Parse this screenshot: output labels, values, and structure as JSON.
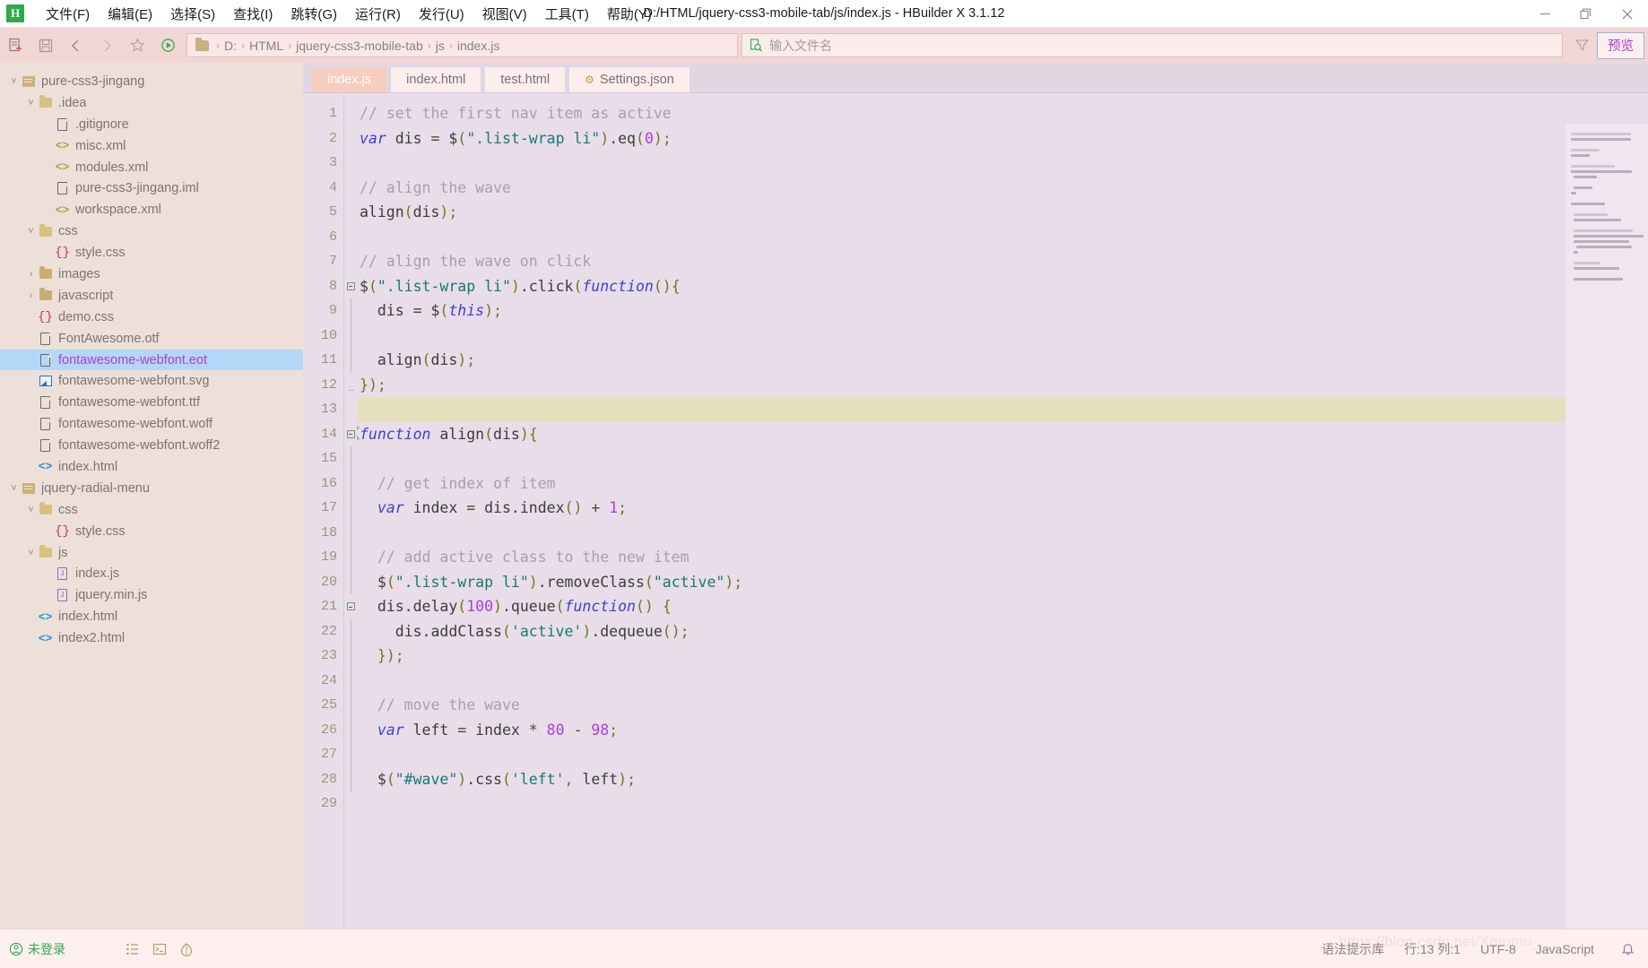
{
  "window": {
    "title": "D:/HTML/jquery-css3-mobile-tab/js/index.js - HBuilder X 3.1.12",
    "logo_letter": "H",
    "controls": {
      "minimize": "—",
      "maximize": "❐",
      "close": "✕"
    }
  },
  "menubar": {
    "items": [
      {
        "label": "文件(F)",
        "name": "menu-file"
      },
      {
        "label": "编辑(E)",
        "name": "menu-edit"
      },
      {
        "label": "选择(S)",
        "name": "menu-select"
      },
      {
        "label": "查找(I)",
        "name": "menu-find"
      },
      {
        "label": "跳转(G)",
        "name": "menu-goto"
      },
      {
        "label": "运行(R)",
        "name": "menu-run"
      },
      {
        "label": "发行(U)",
        "name": "menu-publish"
      },
      {
        "label": "视图(V)",
        "name": "menu-view"
      },
      {
        "label": "工具(T)",
        "name": "menu-tools"
      },
      {
        "label": "帮助(Y)",
        "name": "menu-help"
      }
    ]
  },
  "toolbar": {
    "icons": [
      "new-file-icon",
      "save-icon",
      "back-icon",
      "forward-icon",
      "star-icon",
      "run-icon"
    ],
    "breadcrumb": [
      "D:",
      "HTML",
      "jquery-css3-mobile-tab",
      "js",
      "index.js"
    ],
    "breadcrumb_separator": "›",
    "filename_placeholder": "输入文件名",
    "filter_icon": "filter-icon",
    "preview_label": "预览"
  },
  "sidebar": {
    "tree": [
      {
        "label": "pure-css3-jingang",
        "indent": 0,
        "twisty": "˅",
        "icon": "project",
        "selected": false
      },
      {
        "label": ".idea",
        "indent": 1,
        "twisty": "˅",
        "icon": "folder",
        "selected": false
      },
      {
        "label": ".gitignore",
        "indent": 2,
        "twisty": "",
        "icon": "file",
        "selected": false
      },
      {
        "label": "misc.xml",
        "indent": 2,
        "twisty": "",
        "icon": "xml",
        "selected": false
      },
      {
        "label": "modules.xml",
        "indent": 2,
        "twisty": "",
        "icon": "xml",
        "selected": false
      },
      {
        "label": "pure-css3-jingang.iml",
        "indent": 2,
        "twisty": "",
        "icon": "file",
        "selected": false
      },
      {
        "label": "workspace.xml",
        "indent": 2,
        "twisty": "",
        "icon": "xml",
        "selected": false
      },
      {
        "label": "css",
        "indent": 1,
        "twisty": "˅",
        "icon": "folder",
        "selected": false
      },
      {
        "label": "style.css",
        "indent": 2,
        "twisty": "",
        "icon": "css",
        "selected": false
      },
      {
        "label": "images",
        "indent": 1,
        "twisty": "›",
        "icon": "folder-closed",
        "selected": false
      },
      {
        "label": "javascript",
        "indent": 1,
        "twisty": "›",
        "icon": "folder-closed",
        "selected": false
      },
      {
        "label": "demo.css",
        "indent": 1,
        "twisty": "",
        "icon": "css",
        "selected": false
      },
      {
        "label": "FontAwesome.otf",
        "indent": 1,
        "twisty": "",
        "icon": "file",
        "selected": false
      },
      {
        "label": "fontawesome-webfont.eot",
        "indent": 1,
        "twisty": "",
        "icon": "file",
        "selected": true
      },
      {
        "label": "fontawesome-webfont.svg",
        "indent": 1,
        "twisty": "",
        "icon": "image",
        "selected": false
      },
      {
        "label": "fontawesome-webfont.ttf",
        "indent": 1,
        "twisty": "",
        "icon": "file",
        "selected": false
      },
      {
        "label": "fontawesome-webfont.woff",
        "indent": 1,
        "twisty": "",
        "icon": "file",
        "selected": false
      },
      {
        "label": "fontawesome-webfont.woff2",
        "indent": 1,
        "twisty": "",
        "icon": "file",
        "selected": false
      },
      {
        "label": "index.html",
        "indent": 1,
        "twisty": "",
        "icon": "html",
        "selected": false
      },
      {
        "label": "jquery-radial-menu",
        "indent": 0,
        "twisty": "˅",
        "icon": "project",
        "selected": false
      },
      {
        "label": "css",
        "indent": 1,
        "twisty": "˅",
        "icon": "folder",
        "selected": false
      },
      {
        "label": "style.css",
        "indent": 2,
        "twisty": "",
        "icon": "css",
        "selected": false
      },
      {
        "label": "js",
        "indent": 1,
        "twisty": "˅",
        "icon": "folder",
        "selected": false
      },
      {
        "label": "index.js",
        "indent": 2,
        "twisty": "",
        "icon": "js",
        "selected": false
      },
      {
        "label": "jquery.min.js",
        "indent": 2,
        "twisty": "",
        "icon": "js",
        "selected": false
      },
      {
        "label": "index.html",
        "indent": 1,
        "twisty": "",
        "icon": "html",
        "selected": false
      },
      {
        "label": "index2.html",
        "indent": 1,
        "twisty": "",
        "icon": "html",
        "selected": false
      }
    ]
  },
  "editor": {
    "tabs": [
      {
        "label": "index.js",
        "active": true,
        "gear": false
      },
      {
        "label": "index.html",
        "active": false,
        "gear": false
      },
      {
        "label": "test.html",
        "active": false,
        "gear": false
      },
      {
        "label": "Settings.json",
        "active": false,
        "gear": true
      }
    ],
    "gear_glyph": "⚙",
    "highlight_line": 13,
    "fold_lines": [
      8,
      14,
      21
    ],
    "lines": [
      {
        "n": 1,
        "tokens": [
          {
            "t": "// set the first nav item as active",
            "c": "cm"
          }
        ]
      },
      {
        "n": 2,
        "tokens": [
          {
            "t": "var",
            "c": "kw"
          },
          {
            "t": " dis ",
            "c": "dl"
          },
          {
            "t": "=",
            "c": "op"
          },
          {
            "t": " $",
            "c": "dl"
          },
          {
            "t": "(",
            "c": "pn"
          },
          {
            "t": "\".list-wrap li\"",
            "c": "str"
          },
          {
            "t": ")",
            "c": "pn"
          },
          {
            "t": ".eq",
            "c": "dl"
          },
          {
            "t": "(",
            "c": "pn"
          },
          {
            "t": "0",
            "c": "num"
          },
          {
            "t": ")",
            "c": "pn"
          },
          {
            "t": ";",
            "c": "pn"
          }
        ]
      },
      {
        "n": 3,
        "tokens": []
      },
      {
        "n": 4,
        "tokens": [
          {
            "t": "// align the wave",
            "c": "cm"
          }
        ]
      },
      {
        "n": 5,
        "tokens": [
          {
            "t": "align",
            "c": "dl"
          },
          {
            "t": "(",
            "c": "pn"
          },
          {
            "t": "dis",
            "c": "dl"
          },
          {
            "t": ")",
            "c": "pn"
          },
          {
            "t": ";",
            "c": "pn"
          }
        ]
      },
      {
        "n": 6,
        "tokens": []
      },
      {
        "n": 7,
        "tokens": [
          {
            "t": "// align the wave on click",
            "c": "cm"
          }
        ]
      },
      {
        "n": 8,
        "tokens": [
          {
            "t": "$",
            "c": "dl"
          },
          {
            "t": "(",
            "c": "pn"
          },
          {
            "t": "\".list-wrap li\"",
            "c": "str"
          },
          {
            "t": ")",
            "c": "pn"
          },
          {
            "t": ".click",
            "c": "dl"
          },
          {
            "t": "(",
            "c": "pn"
          },
          {
            "t": "function",
            "c": "kw"
          },
          {
            "t": "()",
            "c": "pn"
          },
          {
            "t": "{",
            "c": "pn"
          }
        ]
      },
      {
        "n": 9,
        "tokens": [
          {
            "t": "  dis ",
            "c": "dl"
          },
          {
            "t": "=",
            "c": "op"
          },
          {
            "t": " $",
            "c": "dl"
          },
          {
            "t": "(",
            "c": "pn"
          },
          {
            "t": "this",
            "c": "kw"
          },
          {
            "t": ")",
            "c": "pn"
          },
          {
            "t": ";",
            "c": "pn"
          }
        ]
      },
      {
        "n": 10,
        "tokens": [
          {
            "t": "  ",
            "c": "dot"
          }
        ]
      },
      {
        "n": 11,
        "tokens": [
          {
            "t": "  align",
            "c": "dl"
          },
          {
            "t": "(",
            "c": "pn"
          },
          {
            "t": "dis",
            "c": "dl"
          },
          {
            "t": ")",
            "c": "pn"
          },
          {
            "t": ";",
            "c": "pn"
          }
        ]
      },
      {
        "n": 12,
        "tokens": [
          {
            "t": "}",
            "c": "pn"
          },
          {
            "t": ")",
            "c": "pn"
          },
          {
            "t": ";",
            "c": "pn"
          }
        ]
      },
      {
        "n": 13,
        "tokens": []
      },
      {
        "n": 14,
        "tokens": [
          {
            "t": "function",
            "c": "kw"
          },
          {
            "t": " align",
            "c": "dl"
          },
          {
            "t": "(",
            "c": "pn"
          },
          {
            "t": "dis",
            "c": "dl"
          },
          {
            "t": ")",
            "c": "pn"
          },
          {
            "t": "{",
            "c": "pn"
          }
        ]
      },
      {
        "n": 15,
        "tokens": [
          {
            "t": "  ",
            "c": "dot"
          }
        ]
      },
      {
        "n": 16,
        "tokens": [
          {
            "t": "  // get index of item",
            "c": "cm"
          }
        ]
      },
      {
        "n": 17,
        "tokens": [
          {
            "t": "  ",
            "c": "dl"
          },
          {
            "t": "var",
            "c": "kw"
          },
          {
            "t": " index ",
            "c": "dl"
          },
          {
            "t": "=",
            "c": "op"
          },
          {
            "t": " dis.index",
            "c": "dl"
          },
          {
            "t": "()",
            "c": "pn"
          },
          {
            "t": " ",
            "c": "dl"
          },
          {
            "t": "+",
            "c": "op"
          },
          {
            "t": " ",
            "c": "dl"
          },
          {
            "t": "1",
            "c": "num"
          },
          {
            "t": ";",
            "c": "pn"
          }
        ]
      },
      {
        "n": 18,
        "tokens": [
          {
            "t": "  ",
            "c": "dot"
          }
        ]
      },
      {
        "n": 19,
        "tokens": [
          {
            "t": "  // add active class to the new item",
            "c": "cm"
          }
        ]
      },
      {
        "n": 20,
        "tokens": [
          {
            "t": "  $",
            "c": "dl"
          },
          {
            "t": "(",
            "c": "pn"
          },
          {
            "t": "\".list-wrap li\"",
            "c": "str"
          },
          {
            "t": ")",
            "c": "pn"
          },
          {
            "t": ".removeClass",
            "c": "dl"
          },
          {
            "t": "(",
            "c": "pn"
          },
          {
            "t": "\"active\"",
            "c": "str"
          },
          {
            "t": ")",
            "c": "pn"
          },
          {
            "t": ";",
            "c": "pn"
          }
        ]
      },
      {
        "n": 21,
        "tokens": [
          {
            "t": "  dis.delay",
            "c": "dl"
          },
          {
            "t": "(",
            "c": "pn"
          },
          {
            "t": "100",
            "c": "num"
          },
          {
            "t": ")",
            "c": "pn"
          },
          {
            "t": ".queue",
            "c": "dl"
          },
          {
            "t": "(",
            "c": "pn"
          },
          {
            "t": "function",
            "c": "kw"
          },
          {
            "t": "()",
            "c": "pn"
          },
          {
            "t": " ",
            "c": "dl"
          },
          {
            "t": "{",
            "c": "pn"
          }
        ]
      },
      {
        "n": 22,
        "tokens": [
          {
            "t": "    dis.addClass",
            "c": "dl"
          },
          {
            "t": "(",
            "c": "pn"
          },
          {
            "t": "'active'",
            "c": "str"
          },
          {
            "t": ")",
            "c": "pn"
          },
          {
            "t": ".dequeue",
            "c": "dl"
          },
          {
            "t": "()",
            "c": "pn"
          },
          {
            "t": ";",
            "c": "pn"
          }
        ]
      },
      {
        "n": 23,
        "tokens": [
          {
            "t": "  }",
            "c": "pn"
          },
          {
            "t": ")",
            "c": "pn"
          },
          {
            "t": ";",
            "c": "pn"
          }
        ]
      },
      {
        "n": 24,
        "tokens": [
          {
            "t": "  ",
            "c": "dot"
          }
        ]
      },
      {
        "n": 25,
        "tokens": [
          {
            "t": "  // move the wave",
            "c": "cm"
          }
        ]
      },
      {
        "n": 26,
        "tokens": [
          {
            "t": "  ",
            "c": "dl"
          },
          {
            "t": "var",
            "c": "kw"
          },
          {
            "t": " left ",
            "c": "dl"
          },
          {
            "t": "=",
            "c": "op"
          },
          {
            "t": " index ",
            "c": "dl"
          },
          {
            "t": "*",
            "c": "op"
          },
          {
            "t": " ",
            "c": "dl"
          },
          {
            "t": "80",
            "c": "num"
          },
          {
            "t": " ",
            "c": "dl"
          },
          {
            "t": "-",
            "c": "op"
          },
          {
            "t": " ",
            "c": "dl"
          },
          {
            "t": "98",
            "c": "num"
          },
          {
            "t": ";",
            "c": "pn"
          }
        ]
      },
      {
        "n": 27,
        "tokens": [
          {
            "t": "  ",
            "c": "dot"
          }
        ]
      },
      {
        "n": 28,
        "tokens": [
          {
            "t": "  $",
            "c": "dl"
          },
          {
            "t": "(",
            "c": "pn"
          },
          {
            "t": "\"#wave\"",
            "c": "str"
          },
          {
            "t": ")",
            "c": "pn"
          },
          {
            "t": ".css",
            "c": "dl"
          },
          {
            "t": "(",
            "c": "pn"
          },
          {
            "t": "'left'",
            "c": "str"
          },
          {
            "t": ",",
            "c": "pn"
          },
          {
            "t": " left",
            "c": "dl"
          },
          {
            "t": ")",
            "c": "pn"
          },
          {
            "t": ";",
            "c": "pn"
          }
        ]
      },
      {
        "n": 29,
        "tokens": [
          {
            "t": "  ",
            "c": "dot"
          }
        ]
      }
    ]
  },
  "statusbar": {
    "login": "未登录",
    "login_icon": "user-circle-icon",
    "icons": [
      "outline-icon",
      "terminal-icon",
      "plugin-icon"
    ],
    "syntax_lib": "语法提示库",
    "cursor": "行:13  列:1",
    "encoding": "UTF-8",
    "language": "JavaScript",
    "bell_icon": "bell-icon",
    "watermark": "https://blog.csdn.net/Xmumu_"
  }
}
